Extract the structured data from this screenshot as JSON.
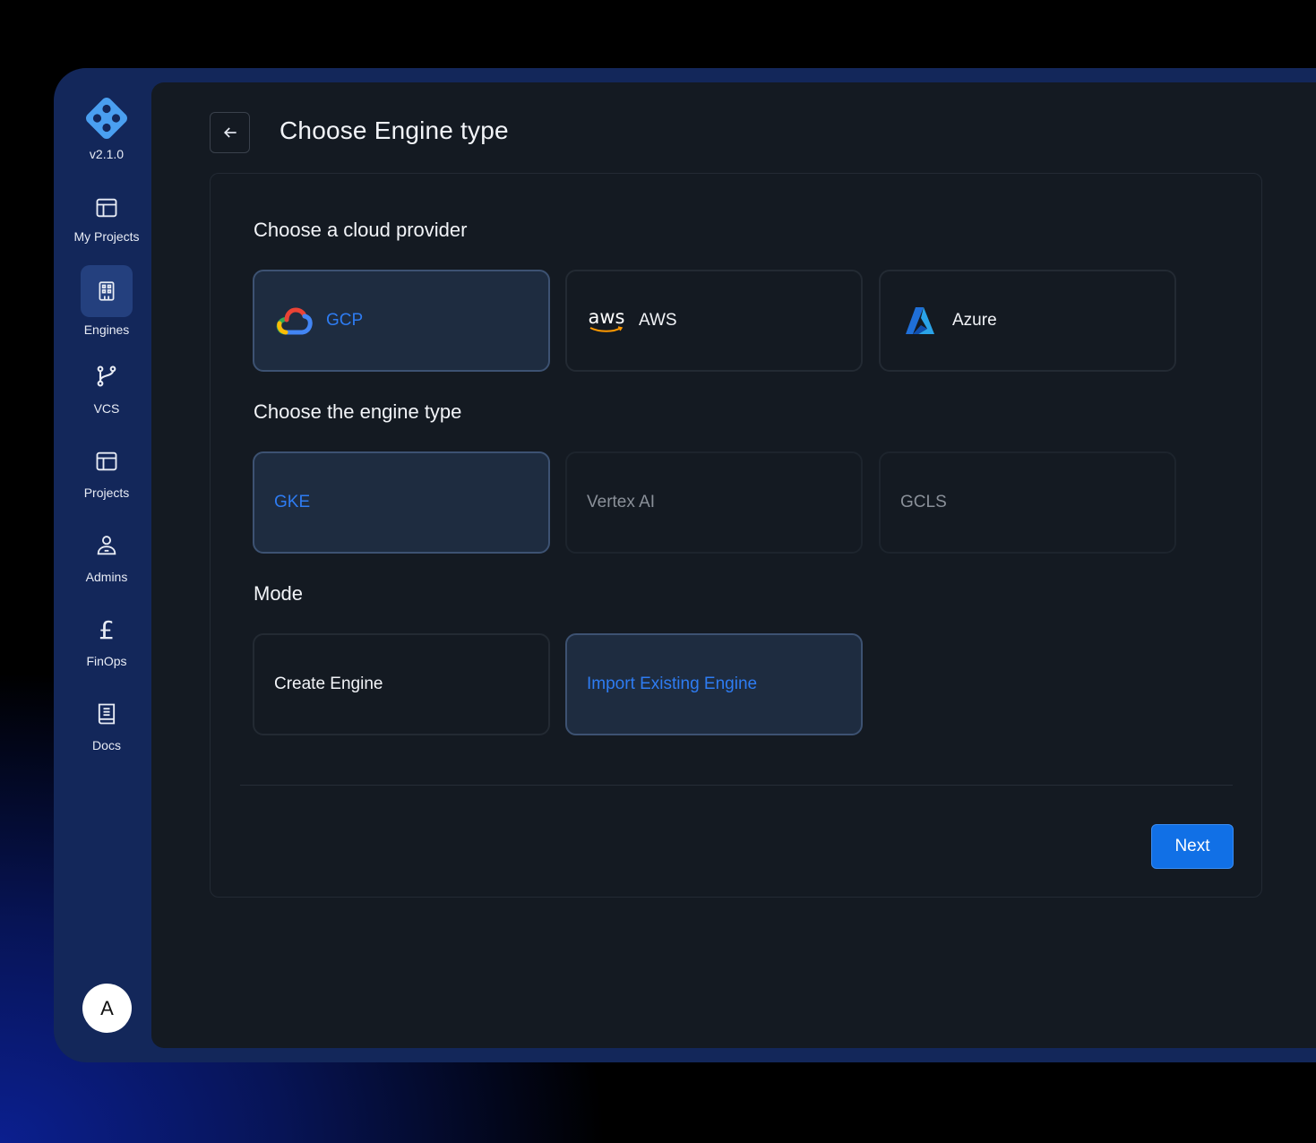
{
  "app": {
    "version": "v2.1.0"
  },
  "sidebar": {
    "items": [
      {
        "label": "My Projects",
        "icon": "layout-icon",
        "active": false
      },
      {
        "label": "Engines",
        "icon": "building-icon",
        "active": true
      },
      {
        "label": "VCS",
        "icon": "git-branch-icon",
        "active": false
      },
      {
        "label": "Projects",
        "icon": "layout-icon",
        "active": false
      },
      {
        "label": "Admins",
        "icon": "user-badge-icon",
        "active": false
      },
      {
        "label": "FinOps",
        "icon": "pound-icon",
        "active": false
      },
      {
        "label": "Docs",
        "icon": "book-icon",
        "active": false
      }
    ],
    "avatar": "A"
  },
  "header": {
    "title": "Choose Engine type"
  },
  "sections": {
    "provider": {
      "title": "Choose a cloud provider",
      "options": [
        {
          "label": "GCP",
          "icon": "gcp-logo-icon",
          "state": "selected"
        },
        {
          "label": "AWS",
          "icon": "aws-logo-icon",
          "icon_text": "aws",
          "state": "normal"
        },
        {
          "label": "Azure",
          "icon": "azure-logo-icon",
          "state": "normal"
        }
      ]
    },
    "engine": {
      "title": "Choose the engine type",
      "options": [
        {
          "label": "GKE",
          "state": "selected"
        },
        {
          "label": "Vertex AI",
          "state": "disabled"
        },
        {
          "label": "GCLS",
          "state": "disabled"
        }
      ]
    },
    "mode": {
      "title": "Mode",
      "options": [
        {
          "label": "Create Engine",
          "state": "normal"
        },
        {
          "label": "Import Existing Engine",
          "state": "selected"
        }
      ]
    }
  },
  "footer": {
    "next_label": "Next"
  },
  "colors": {
    "accent": "#1170e6",
    "selected_text": "#2e7cf2",
    "sidebar": "#13275a",
    "panel": "#141a22"
  }
}
